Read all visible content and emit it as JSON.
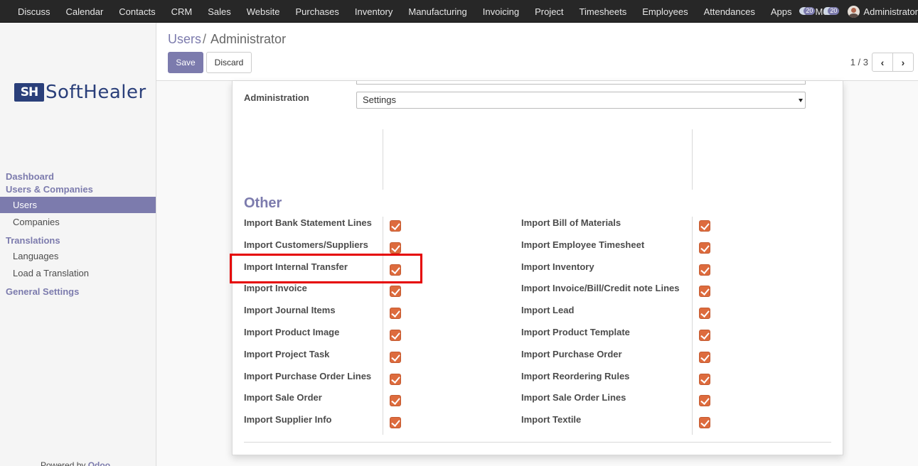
{
  "topbar": {
    "menu": [
      "Discuss",
      "Calendar",
      "Contacts",
      "CRM",
      "Sales",
      "Website",
      "Purchases",
      "Inventory",
      "Manufacturing",
      "Invoicing",
      "Project",
      "Timesheets",
      "Employees",
      "Attendances",
      "Apps",
      "More"
    ],
    "activity_count": "20",
    "messages_count": "20",
    "user_name": "Administrator"
  },
  "sidebar": {
    "logo_mark": "SH",
    "logo_text": "SoftHealer",
    "dashboard": "Dashboard",
    "users_companies": "Users & Companies",
    "users": "Users",
    "companies": "Companies",
    "translations": "Translations",
    "languages": "Languages",
    "load_translation": "Load a Translation",
    "general_settings": "General Settings",
    "powered_prefix": "Powered by",
    "powered_brand": "Odoo"
  },
  "control_panel": {
    "breadcrumb_parent": "Users",
    "breadcrumb_current": "Administrator",
    "save_label": "Save",
    "discard_label": "Discard",
    "pager": "1 / 3"
  },
  "form": {
    "administration_label": "Administration",
    "administration_value": "Settings",
    "section_title": "Other",
    "left_rows": [
      {
        "label": "Import Bank Statement Lines",
        "checked": true
      },
      {
        "label": "Import Customers/Suppliers",
        "checked": true
      },
      {
        "label": "Import Internal Transfer",
        "checked": true
      },
      {
        "label": "Import Invoice",
        "checked": true
      },
      {
        "label": "Import Journal Items",
        "checked": true
      },
      {
        "label": "Import Product Image",
        "checked": true
      },
      {
        "label": "Import Project Task",
        "checked": true
      },
      {
        "label": "Import Purchase Order Lines",
        "checked": true
      },
      {
        "label": "Import Sale Order",
        "checked": true
      },
      {
        "label": "Import Supplier Info",
        "checked": true
      }
    ],
    "right_rows": [
      {
        "label": "Import Bill of Materials",
        "checked": true
      },
      {
        "label": "Import Employee Timesheet",
        "checked": true
      },
      {
        "label": "Import Inventory",
        "checked": true
      },
      {
        "label": "Import Invoice/Bill/Credit note Lines",
        "checked": true
      },
      {
        "label": "Import Lead",
        "checked": true
      },
      {
        "label": "Import Product Template",
        "checked": true
      },
      {
        "label": "Import Purchase Order",
        "checked": true
      },
      {
        "label": "Import Reordering Rules",
        "checked": true
      },
      {
        "label": "Import Sale Order Lines",
        "checked": true
      },
      {
        "label": "Import Textile",
        "checked": true
      }
    ]
  },
  "colors": {
    "accent": "#7c7bad",
    "checkbox": "#dd6b3d",
    "highlight": "#e50000"
  }
}
